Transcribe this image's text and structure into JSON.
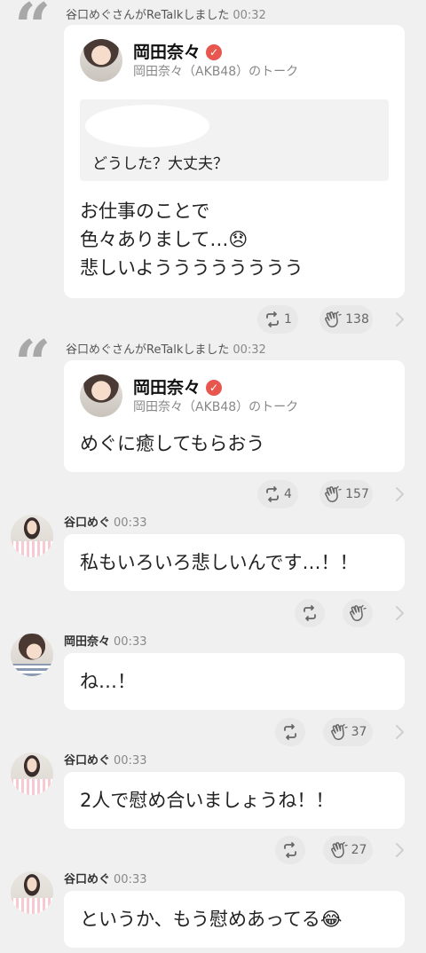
{
  "posts": [
    {
      "type": "retalk",
      "header": "谷口めぐさんがReTalkしました",
      "time": "00:32",
      "talk_name": "岡田奈々",
      "talk_sub": "岡田奈々（AKB48）のトーク",
      "quoted_text": "どうした？大丈夫？",
      "body_lines": [
        "お仕事のことで",
        "色々ありまして…😞",
        "悲しいようううううううう"
      ],
      "retalk_count": "1",
      "clap_count": "138"
    },
    {
      "type": "retalk",
      "header": "谷口めぐさんがReTalkしました",
      "time": "00:32",
      "talk_name": "岡田奈々",
      "talk_sub": "岡田奈々（AKB48）のトーク",
      "body": "めぐに癒してもらおう",
      "retalk_count": "4",
      "clap_count": "157"
    },
    {
      "type": "talk",
      "author": "谷口めぐ",
      "time": "00:33",
      "body": "私もいろいろ悲しいんです…！！",
      "retalk_count": "",
      "clap_count": ""
    },
    {
      "type": "talk",
      "author": "岡田奈々",
      "time": "00:33",
      "body": "ね…！",
      "retalk_count": "",
      "clap_count": "37"
    },
    {
      "type": "talk",
      "author": "谷口めぐ",
      "time": "00:33",
      "body": "2人で慰め合いましょうね！！",
      "retalk_count": "",
      "clap_count": "27"
    },
    {
      "type": "talk",
      "author": "谷口めぐ",
      "time": "00:33",
      "body": "というか、もう慰めあってる😂"
    }
  ],
  "icons": {
    "quote": "quote-icon",
    "retalk": "retalk-icon",
    "clap": "clap-icon",
    "chevron": "chevron-right-icon",
    "verified": "verified-badge-icon"
  },
  "colors": {
    "background": "#f0f0f0",
    "card": "#ffffff",
    "verified": "#e8574f",
    "pill": "#e8e8e8"
  }
}
